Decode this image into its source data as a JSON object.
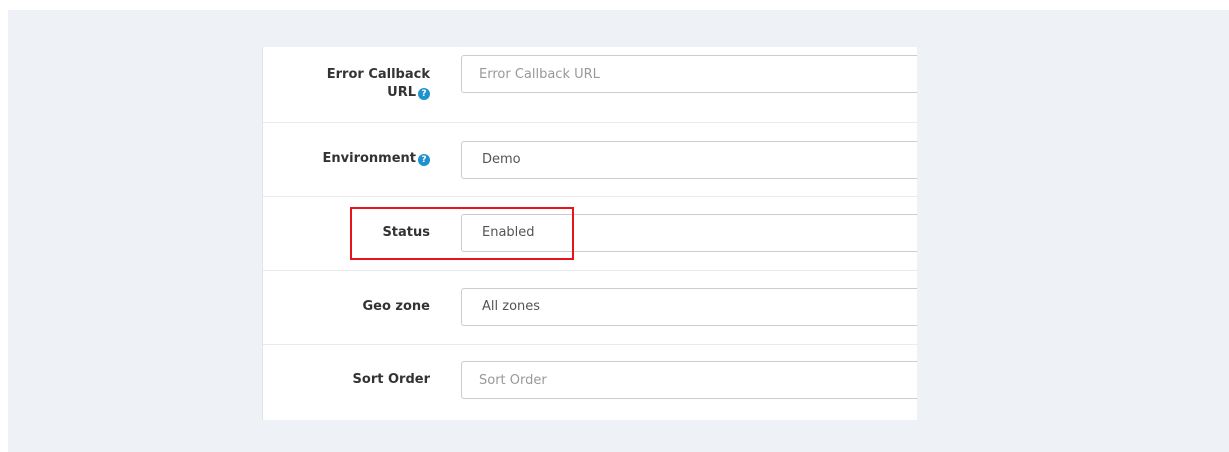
{
  "form": {
    "rows": [
      {
        "label_line1": "Error Callback",
        "label_line2": "URL",
        "help": "?",
        "placeholder": "Error Callback URL",
        "value": ""
      },
      {
        "label": "Environment",
        "help": "?",
        "selected": "Demo"
      },
      {
        "label": "Status",
        "selected": "Enabled"
      },
      {
        "label": "Geo zone",
        "selected": "All zones"
      },
      {
        "label": "Sort Order",
        "placeholder": "Sort Order",
        "value": ""
      }
    ]
  },
  "annotation": {
    "highlight_color": "#e8141b",
    "target": "Status"
  },
  "colors": {
    "background": "#eef1f6",
    "help_icon": "#1e91cf",
    "label_text": "#333333"
  }
}
